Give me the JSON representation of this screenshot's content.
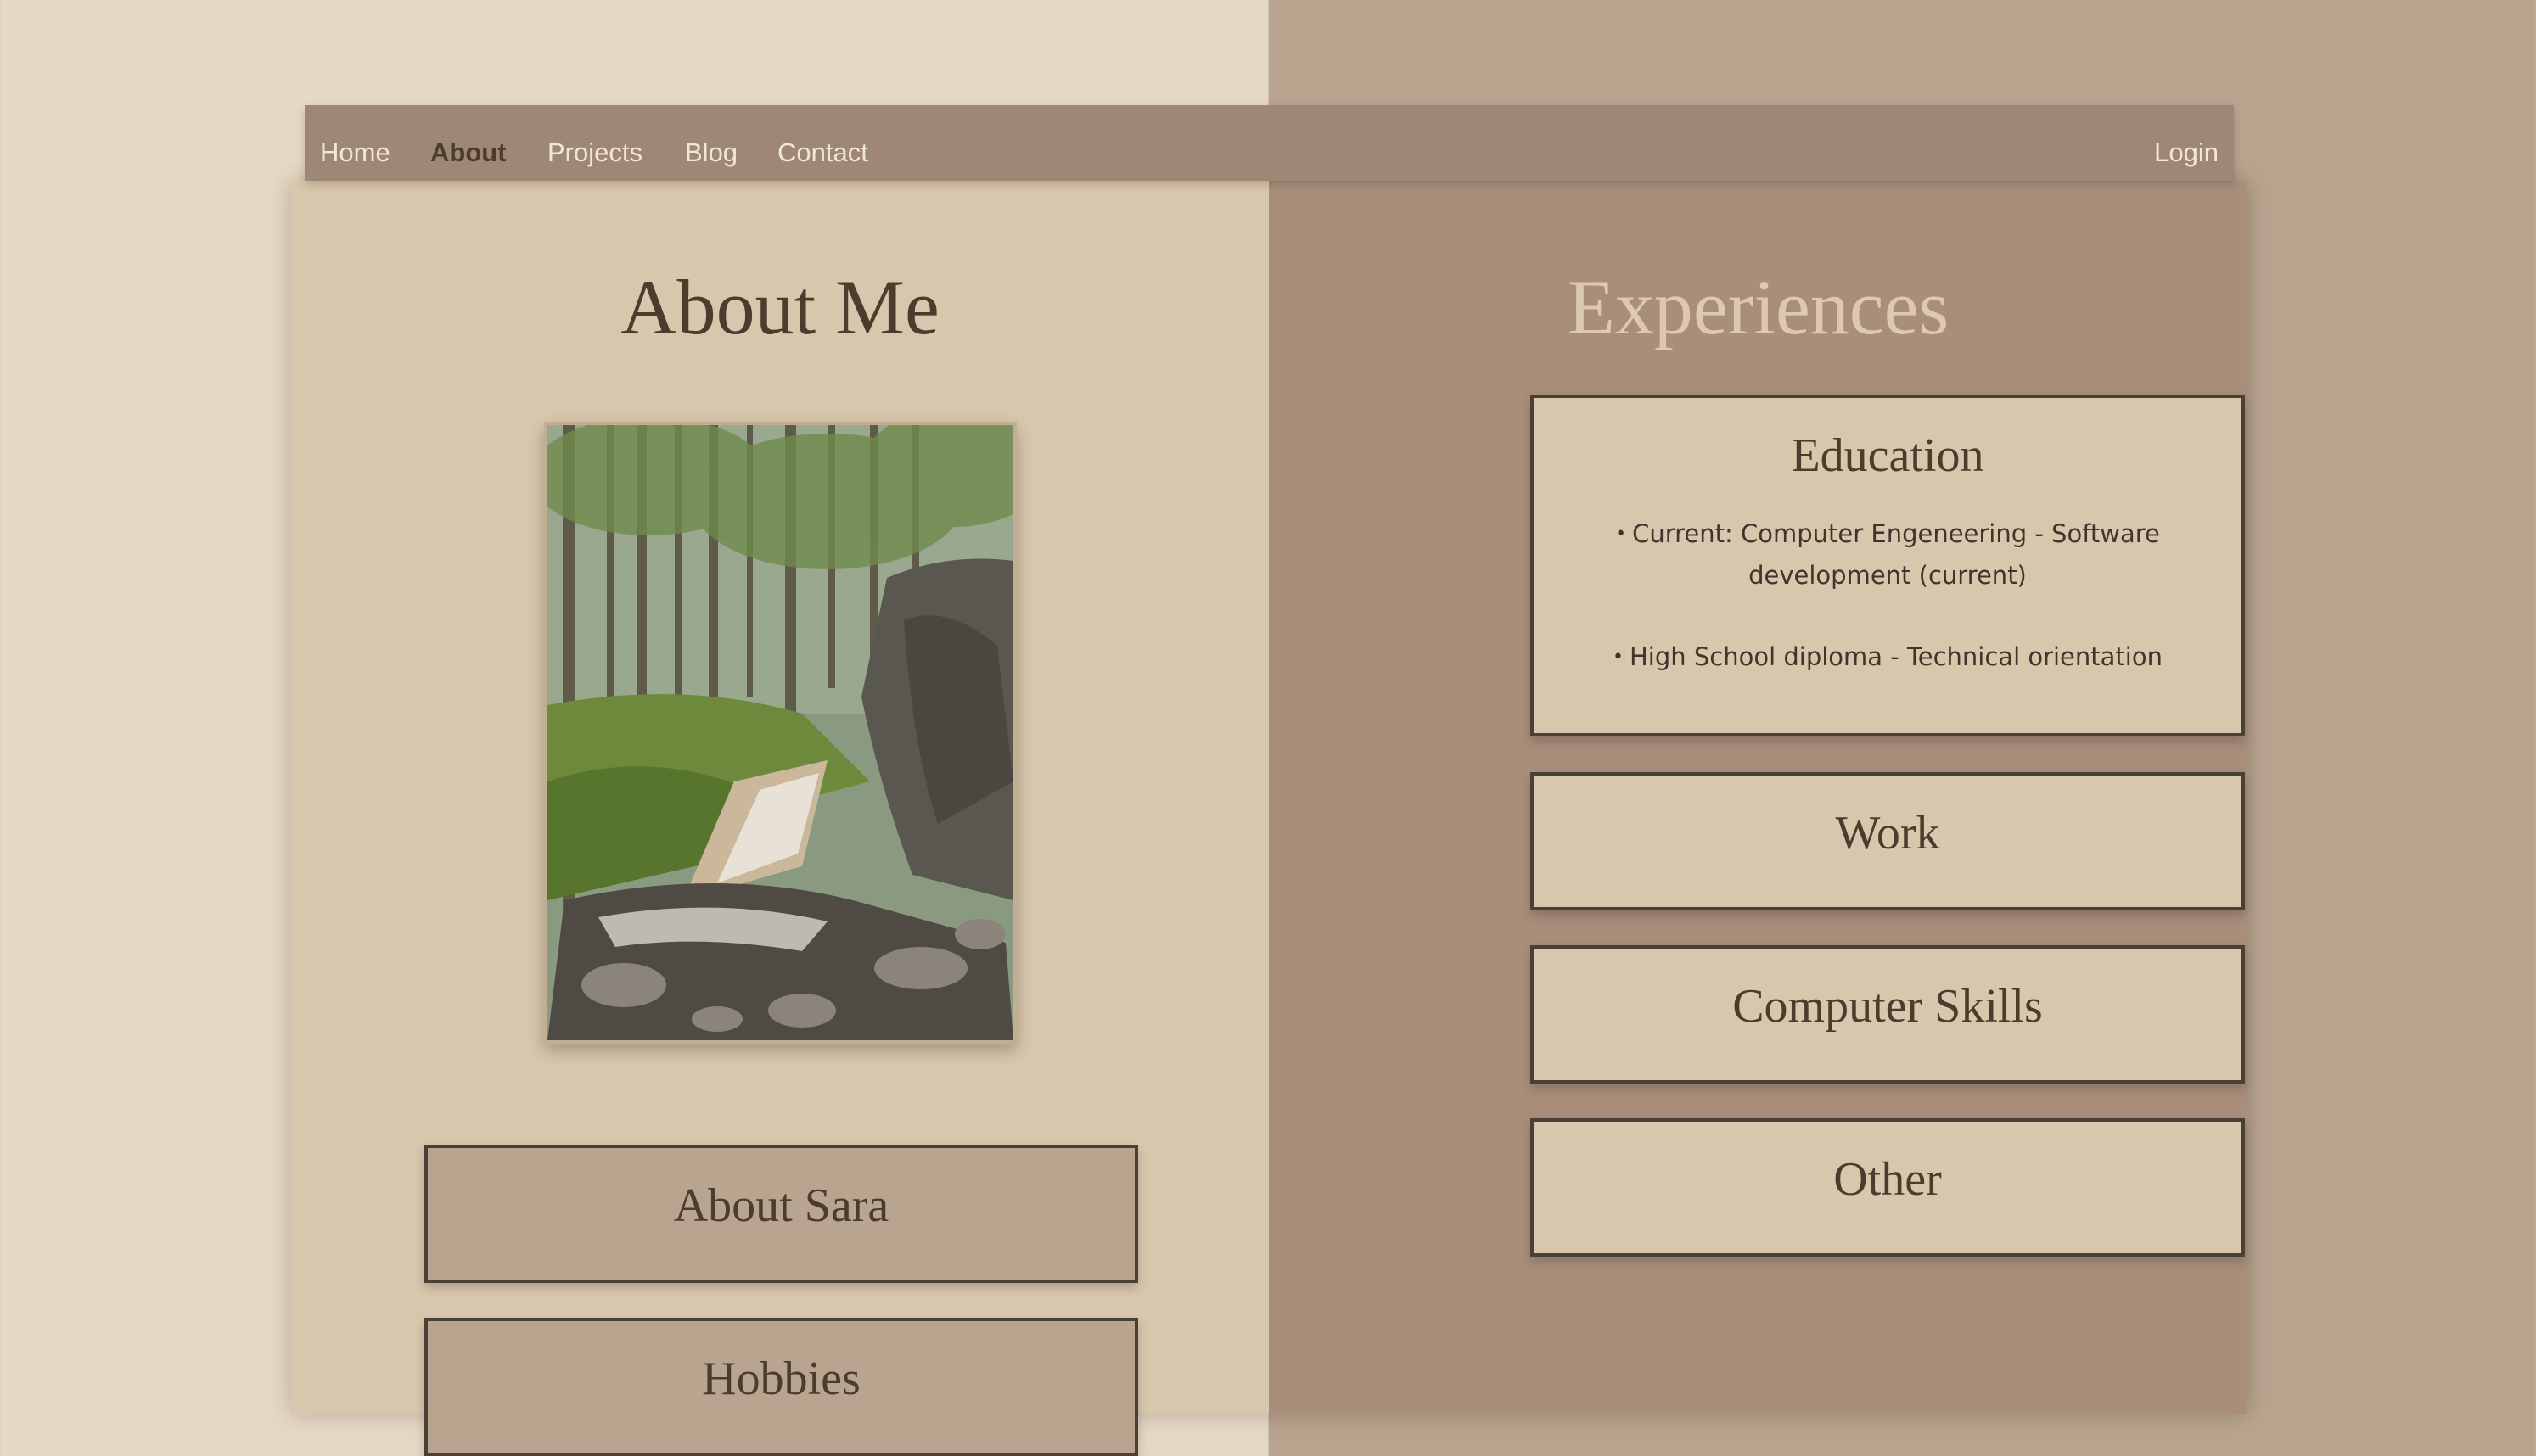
{
  "nav": {
    "left_items": [
      {
        "label": "Home"
      },
      {
        "label": "About",
        "active": true
      },
      {
        "label": "Projects"
      },
      {
        "label": "Blog"
      },
      {
        "label": "Contact"
      }
    ],
    "login_label": "Login"
  },
  "about": {
    "title": "About Me",
    "sections": [
      "About Sara",
      "Hobbies"
    ]
  },
  "experiences": {
    "title": "Experiences",
    "education": {
      "title": "Education",
      "items": [
        "Current: Computer Engeneering - Software development (current)",
        "High School diploma - Technical orientation"
      ]
    },
    "sections": [
      "Work",
      "Computer Skills",
      "Other"
    ]
  },
  "colors": {
    "page_bg_left": "#e6d9c4",
    "page_bg_right": "#b9a48f",
    "navbar": "#9e8774",
    "card_left": "#d9c7ad",
    "card_right": "#a98e7a",
    "text_dark": "#4b3d2e"
  }
}
